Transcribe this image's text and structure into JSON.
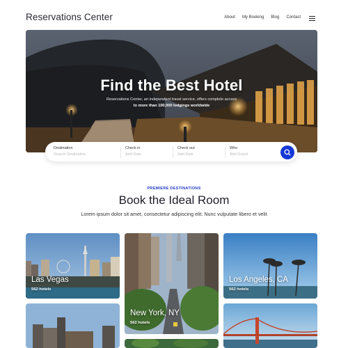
{
  "header": {
    "brand": "Reservations Center",
    "nav": [
      "About",
      "My Booking",
      "Blog",
      "Contact"
    ]
  },
  "hero": {
    "title": "Find the Best Hotel",
    "subtitle": "Reservations Center, an independent travel service, offers complete access",
    "subtitle_bold": "to more than 100,000 lodgings worldwide"
  },
  "search": {
    "destination": {
      "label": "Destination",
      "placeholder": "Search Destination"
    },
    "checkin": {
      "label": "Check in",
      "placeholder": "Add Date"
    },
    "checkout": {
      "label": "Check out",
      "placeholder": "Add Date"
    },
    "who": {
      "label": "Who",
      "placeholder": "Add Guest"
    }
  },
  "section": {
    "eyebrow": "PREMIERE DESTINATIONS",
    "title": "Book the Ideal Room",
    "text": "Lorem ipsum dolor sit amet, consectetur adipiscing elit. Nunc vulputate libero et velit"
  },
  "destinations": [
    {
      "city": "Las Vegas",
      "count": "562 hotels"
    },
    {
      "city": "New York, NY",
      "count": "562 hotels"
    },
    {
      "city": "Los Angeles, CA",
      "count": "562 hotels"
    }
  ],
  "colors": {
    "accent": "#1538d6",
    "eyebrow": "#2238c8"
  }
}
